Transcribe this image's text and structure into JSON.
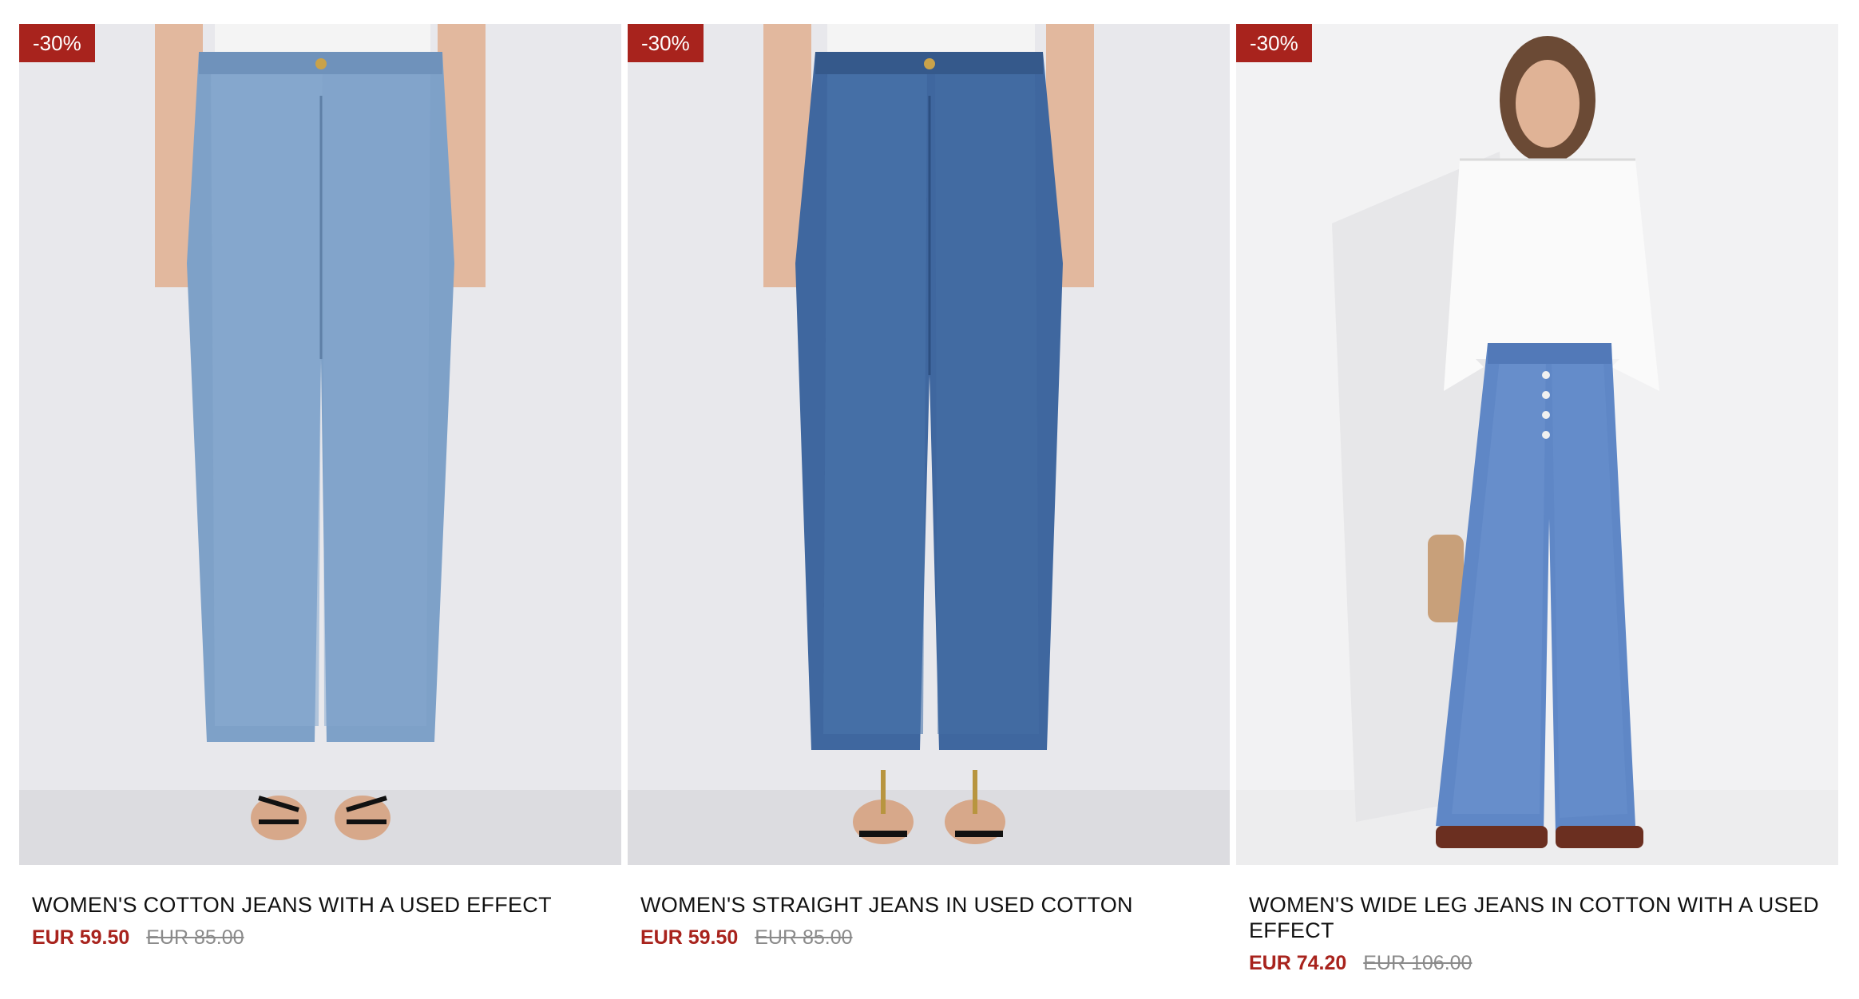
{
  "products": [
    {
      "discount": "-30%",
      "name": "WOMEN'S COTTON JEANS WITH A USED EFFECT",
      "price_now": "EUR 59.50",
      "price_old": "EUR 85.00",
      "image_alt": "light-wash-barrel-jeans-photo"
    },
    {
      "discount": "-30%",
      "name": "WOMEN'S STRAIGHT JEANS IN USED COTTON",
      "price_now": "EUR 59.50",
      "price_old": "EUR 85.00",
      "image_alt": "mid-wash-straight-jeans-photo"
    },
    {
      "discount": "-30%",
      "name": "WOMEN'S WIDE LEG JEANS IN COTTON WITH A USED EFFECT",
      "price_now": "EUR 74.20",
      "price_old": "EUR 106.00",
      "image_alt": "wide-leg-jeans-model-photo"
    }
  ],
  "colors": {
    "accent": "#a8231d",
    "old_price": "#8a8a8a",
    "image_bg": "#e9e9ec"
  }
}
